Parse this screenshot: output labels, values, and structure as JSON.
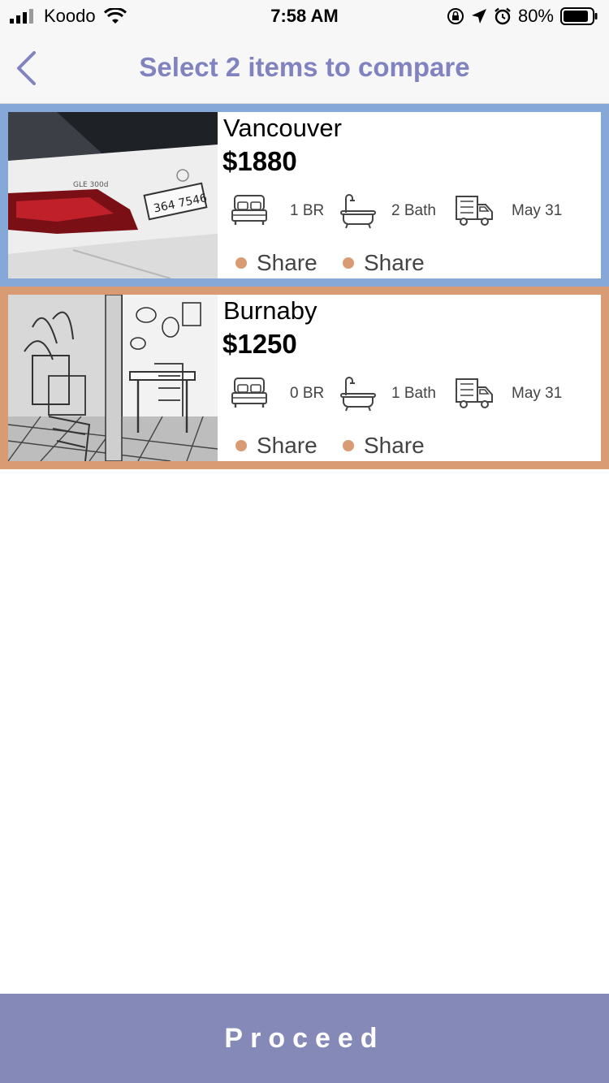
{
  "status_bar": {
    "carrier": "Koodo",
    "time": "7:58 AM",
    "battery": "80%"
  },
  "nav": {
    "title": "Select 2 items to compare"
  },
  "listings": [
    {
      "city": "Vancouver",
      "price": "$1880",
      "bedrooms": "1 BR",
      "bathrooms": "2 Bath",
      "move_in": "May 31",
      "tags": [
        "Share",
        "Share"
      ]
    },
    {
      "city": "Burnaby",
      "price": "$1250",
      "bedrooms": "0 BR",
      "bathrooms": "1 Bath",
      "move_in": "May 31",
      "tags": [
        "Share",
        "Share"
      ]
    }
  ],
  "footer": {
    "proceed_label": "Proceed"
  },
  "colors": {
    "accent": "#8083bf",
    "card1_border": "#85a8d9",
    "card2_border": "#d99b73",
    "proceed_bg": "#8589b8",
    "tag_dot": "#d99b73"
  }
}
